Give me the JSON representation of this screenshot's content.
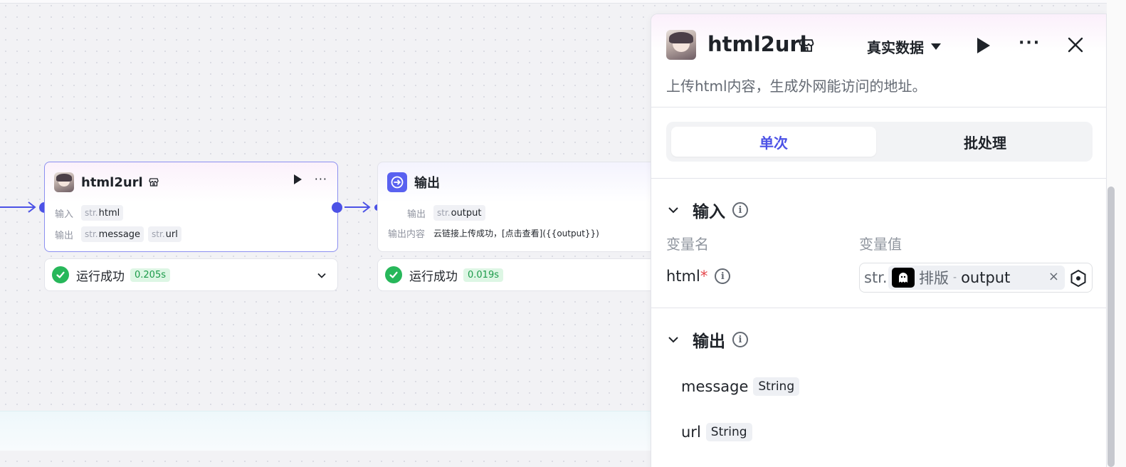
{
  "canvas": {
    "node_html2url": {
      "title": "html2url",
      "input_label": "输入",
      "output_label": "输出",
      "inputs": [
        {
          "type": "str.",
          "name": "html"
        }
      ],
      "outputs": [
        {
          "type": "str.",
          "name": "message"
        },
        {
          "type": "str.",
          "name": "url"
        }
      ],
      "status": "运行成功",
      "time": "0.205s"
    },
    "node_output": {
      "title": "输出",
      "output_label": "输出",
      "outputs": [
        {
          "type": "str.",
          "name": "output"
        }
      ],
      "content_label": "输出内容",
      "content": "云链接上传成功，[点击查看]({{output}})",
      "status": "运行成功",
      "time": "0.019s"
    }
  },
  "panel": {
    "title": "html2url",
    "mode": "真实数据",
    "description": "上传html内容，生成外网能访问的地址。",
    "tabs": [
      "单次",
      "批处理"
    ],
    "input_section": "输入",
    "col_name": "变量名",
    "col_value": "变量值",
    "var": {
      "name": "html",
      "required_mark": "*",
      "type_prefix": "str.",
      "ref_node": "排版",
      "ref_sep": "-",
      "ref_var": "output",
      "clear": "×"
    },
    "output_section": "输出",
    "outputs": [
      {
        "name": "message",
        "type": "String"
      },
      {
        "name": "url",
        "type": "String"
      }
    ]
  },
  "colors": {
    "accent": "#4c52e6",
    "success": "#27b75a",
    "required": "#e5484d"
  }
}
